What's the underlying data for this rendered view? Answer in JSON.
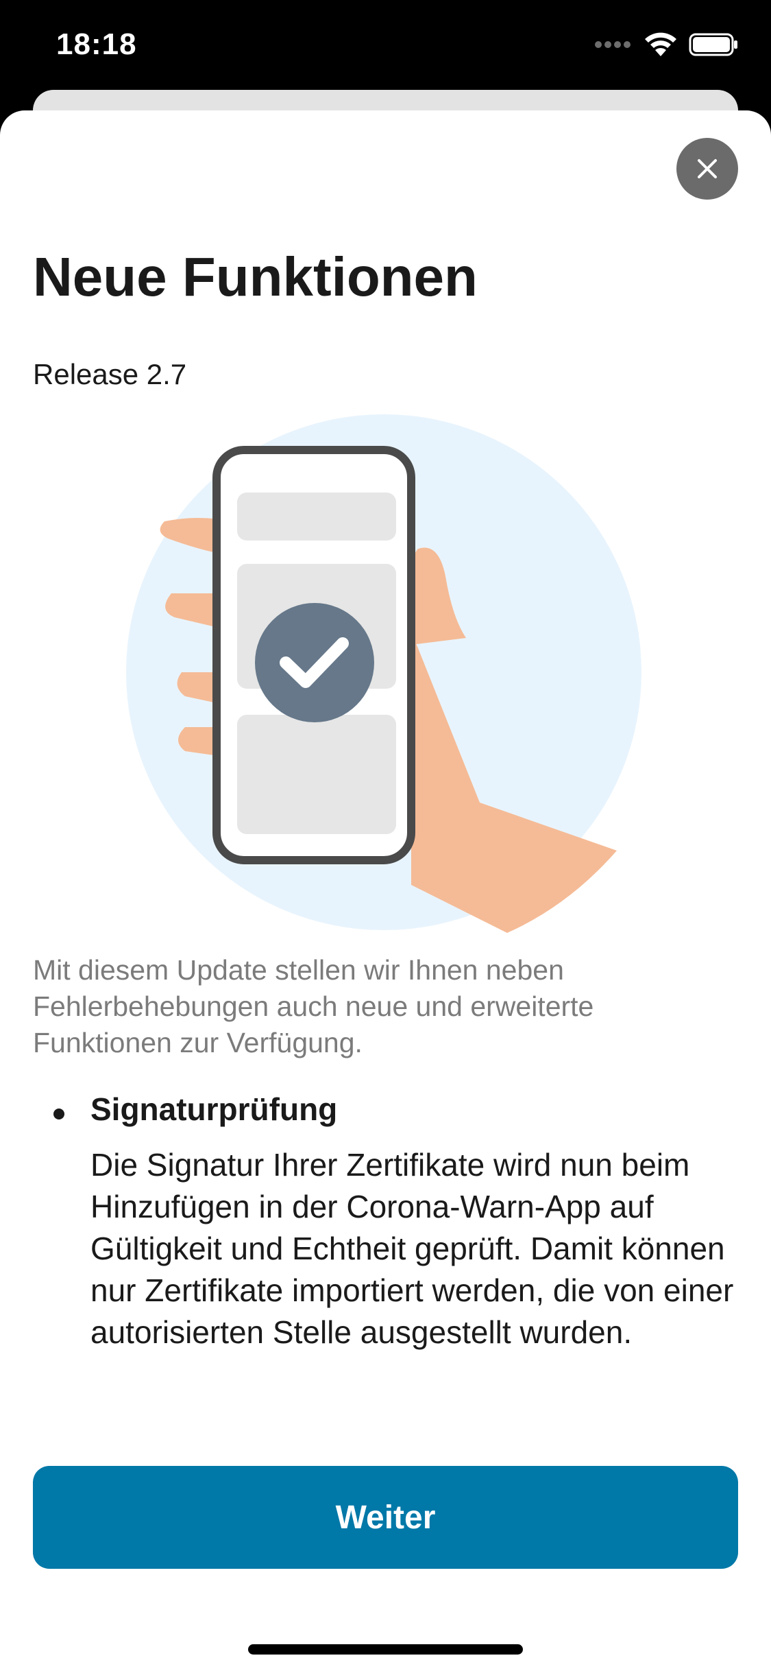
{
  "status_bar": {
    "time": "18:18"
  },
  "sheet": {
    "title": "Neue Funktionen",
    "release": "Release 2.7",
    "intro": "Mit diesem Update stellen wir Ihnen neben Fehlerbehebungen auch neue und erweiterte Funktionen zur Verfügung.",
    "features": [
      {
        "title": "Signaturprüfung",
        "text": "Die Signatur Ihrer Zertifikate wird nun beim Hinzufügen in der Corona-Warn-App auf Gültigkeit und Echtheit geprüft. Damit können nur Zertifikate importiert werden, die von einer autorisierten Stelle ausgestellt wurden."
      }
    ],
    "primary_button_label": "Weiter"
  },
  "icons": {
    "close": "close-icon",
    "wifi": "wifi-icon",
    "battery": "battery-icon",
    "signal": "cellular-signal-icon",
    "check": "checkmark-icon"
  },
  "colors": {
    "accent": "#0078a8",
    "close_button": "#6b6b6b",
    "illustration_bg": "#e8f4fd",
    "hand": "#f5bb96",
    "check_circle": "#66788a"
  }
}
